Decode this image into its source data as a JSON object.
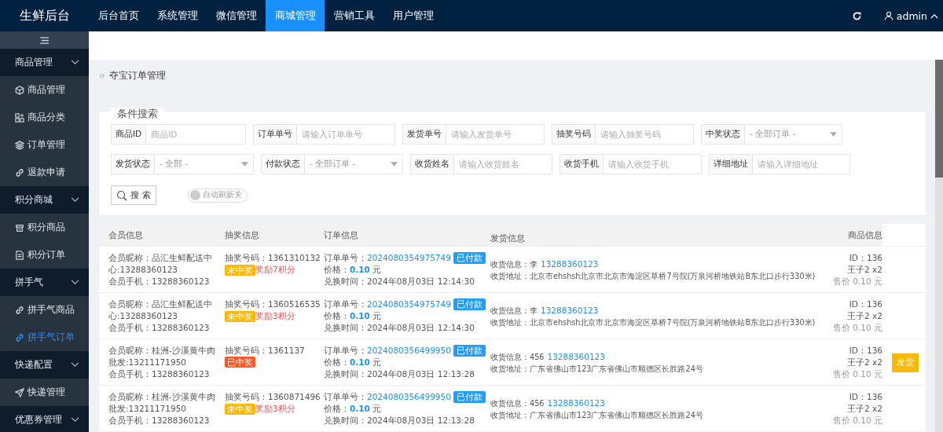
{
  "topbar": {
    "brand": "生鲜后台",
    "tabs": [
      {
        "label": "后台首页",
        "selected": false
      },
      {
        "label": "系统管理",
        "selected": false
      },
      {
        "label": "微信管理",
        "selected": false
      },
      {
        "label": "商城管理",
        "selected": true
      },
      {
        "label": "营销工具",
        "selected": false
      },
      {
        "label": "用户管理",
        "selected": false
      }
    ],
    "user": "admin"
  },
  "sidebar": {
    "groups": [
      {
        "label": "商品管理",
        "expanded": true,
        "children": [
          {
            "label": "商品管理",
            "selected": false
          },
          {
            "label": "商品分类",
            "selected": false
          },
          {
            "label": "订单管理",
            "selected": false
          },
          {
            "label": "退款申请",
            "selected": false
          }
        ]
      },
      {
        "label": "积分商城",
        "expanded": true,
        "children": [
          {
            "label": "积分商品",
            "selected": false
          },
          {
            "label": "积分订单",
            "selected": false
          }
        ]
      },
      {
        "label": "拼手气",
        "expanded": true,
        "children": [
          {
            "label": "拼手气商品",
            "selected": false
          },
          {
            "label": "拼手气订单",
            "selected": true
          }
        ]
      },
      {
        "label": "快递配置",
        "expanded": true,
        "children": [
          {
            "label": "快递管理",
            "selected": false
          }
        ]
      },
      {
        "label": "优惠券管理",
        "expanded": true
      }
    ]
  },
  "breadcrumb": "夺宝订单管理",
  "search": {
    "title": "条件搜索",
    "fields": [
      {
        "kind": "text",
        "label": "商品ID",
        "placeholder": "商品ID"
      },
      {
        "kind": "text",
        "label": "订单单号",
        "placeholder": "请输入订单单号"
      },
      {
        "kind": "text",
        "label": "发货单号",
        "placeholder": "请输入发货单号"
      },
      {
        "kind": "text",
        "label": "抽奖号码",
        "placeholder": "请输入抽奖号码"
      },
      {
        "kind": "select",
        "label": "中奖状态",
        "value": "- 全部订单 -"
      },
      {
        "kind": "select",
        "label": "发货状态",
        "value": "- 全部 -"
      },
      {
        "kind": "select",
        "label": "付款状态",
        "value": "- 全部订单 -"
      },
      {
        "kind": "text",
        "label": "收货姓名",
        "placeholder": "请输入收货姓名"
      },
      {
        "kind": "text",
        "label": "收货手机",
        "placeholder": "请输入收货手机"
      },
      {
        "kind": "text",
        "label": "详细地址",
        "placeholder": "请输入详细地址"
      }
    ],
    "button": "搜 索",
    "toggle": {
      "label": "自动刷新关",
      "on": false
    }
  },
  "table": {
    "columns": [
      "会员信息",
      "抽奖信息",
      "订单信息",
      "发货信息",
      "商品信息"
    ],
    "rows": [
      {
        "nickname": "会员昵称：品汇生鲜配送中心:13288360123",
        "phone": "会员手机：13288360123",
        "lottery": "抽奖号码：1361310132",
        "prize": {
          "label": "未中奖",
          "won": false
        },
        "reward": "奖励7积分",
        "order_label": "订单单号：",
        "order_no": "2024080354975749",
        "paid": "已付款",
        "price": "价格：**0.10** 元",
        "time": "兑换时间：2024年08月03日 12:14:30",
        "receiver": "收货信息：李",
        "receiver_phone": "13288360123",
        "address": "收货地址：北京市ehshsh北京市北京市海淀区草桥7号院(万泉河桥地铁站B东北口步行330米)",
        "goods_id": "ID：136",
        "goods_name": "王子2 x2",
        "goods_price": "售价 0.10 元"
      },
      {
        "nickname": "会员昵称：品汇生鲜配送中心:13288360123",
        "phone": "会员手机：13288360123",
        "lottery": "抽奖号码：1360516535",
        "prize": {
          "label": "未中奖",
          "won": false
        },
        "reward": "奖励3积分",
        "order_label": "订单单号：",
        "order_no": "2024080354975749",
        "paid": "已付款",
        "price": "价格：**0.10** 元",
        "time": "兑换时间：2024年08月03日 12:14:30",
        "receiver": "收货信息：李",
        "receiver_phone": "13288360123",
        "address": "收货地址：北京市ehshsh北京市北京市海淀区草桥7号院(万泉河桥地铁站B东北口步行330米)",
        "goods_id": "ID：136",
        "goods_name": "王子2 x2",
        "goods_price": "售价 0.10 元"
      },
      {
        "nickname": "会员昵称：桂洲-沙溪黄牛肉批发:13211171950",
        "phone": "会员手机：13288360123",
        "lottery": "抽奖号码：1361137",
        "prize": {
          "label": "已中奖",
          "won": true
        },
        "order_label": "订单单号：",
        "order_no": "2024080356499950",
        "paid": "已付款",
        "price": "价格：**0.10** 元",
        "time": "兑换时间：2024年08月03日 12:13:28",
        "receiver": "收货信息：456",
        "receiver_phone": "13288360123",
        "address": "收货地址：广东省佛山市123广东省佛山市顺德区长胜路24号",
        "goods_id": "ID：136",
        "goods_name": "王子2 x2",
        "goods_price": "售价 0.10 元",
        "action": "发货"
      },
      {
        "nickname": "会员昵称：桂洲-沙溪黄牛肉批发:13211171950",
        "phone": "会员手机：13288360123",
        "lottery": "抽奖号码：1360871496",
        "prize": {
          "label": "未中奖",
          "won": false
        },
        "reward": "奖励3积分",
        "order_label": "订单单号：",
        "order_no": "2024080356499950",
        "paid": "已付款",
        "price": "价格：**0.10** 元",
        "time": "兑换时间：2024年08月03日 12:13:28",
        "receiver": "收货信息：456",
        "receiver_phone": "13288360123",
        "address": "收货地址：广东省佛山市123广东省佛山市顺德区长胜路24号",
        "goods_id": "ID：136",
        "goods_name": "王子2 x2",
        "goods_price": "售价 0.10 元"
      }
    ]
  }
}
